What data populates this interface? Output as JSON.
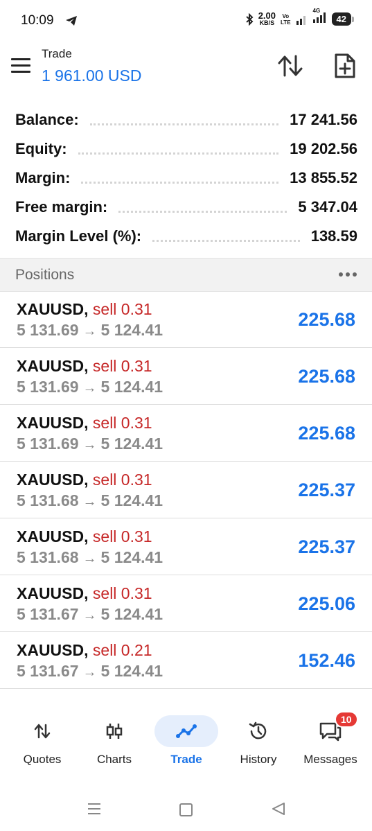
{
  "status_bar": {
    "time": "10:09",
    "speed_value": "2.00",
    "speed_unit": "KB/S",
    "volte_top": "Vo",
    "volte_bottom": "LTE",
    "network": "4G",
    "battery": "42"
  },
  "header": {
    "title": "Trade",
    "subtitle": "1 961.00 USD"
  },
  "summary": [
    {
      "label": "Balance:",
      "value": "17 241.56"
    },
    {
      "label": "Equity:",
      "value": "19 202.56"
    },
    {
      "label": "Margin:",
      "value": "13 855.52"
    },
    {
      "label": "Free margin:",
      "value": "5 347.04"
    },
    {
      "label": "Margin Level (%):",
      "value": "138.59"
    }
  ],
  "positions": {
    "title": "Positions",
    "items": [
      {
        "symbol": "XAUUSD,",
        "side": "sell 0.31",
        "open_price": "5 131.69",
        "arrow": "→",
        "current_price": "5 124.41",
        "profit": "225.68"
      },
      {
        "symbol": "XAUUSD,",
        "side": "sell 0.31",
        "open_price": "5 131.69",
        "arrow": "→",
        "current_price": "5 124.41",
        "profit": "225.68"
      },
      {
        "symbol": "XAUUSD,",
        "side": "sell 0.31",
        "open_price": "5 131.69",
        "arrow": "→",
        "current_price": "5 124.41",
        "profit": "225.68"
      },
      {
        "symbol": "XAUUSD,",
        "side": "sell 0.31",
        "open_price": "5 131.68",
        "arrow": "→",
        "current_price": "5 124.41",
        "profit": "225.37"
      },
      {
        "symbol": "XAUUSD,",
        "side": "sell 0.31",
        "open_price": "5 131.68",
        "arrow": "→",
        "current_price": "5 124.41",
        "profit": "225.37"
      },
      {
        "symbol": "XAUUSD,",
        "side": "sell 0.31",
        "open_price": "5 131.67",
        "arrow": "→",
        "current_price": "5 124.41",
        "profit": "225.06"
      },
      {
        "symbol": "XAUUSD,",
        "side": "sell 0.21",
        "open_price": "5 131.67",
        "arrow": "→",
        "current_price": "5 124.41",
        "profit": "152.46"
      }
    ]
  },
  "nav": {
    "items": [
      {
        "label": "Quotes",
        "icon": "quotes-icon"
      },
      {
        "label": "Charts",
        "icon": "charts-icon"
      },
      {
        "label": "Trade",
        "icon": "trade-icon",
        "active": true
      },
      {
        "label": "History",
        "icon": "history-icon"
      },
      {
        "label": "Messages",
        "icon": "messages-icon",
        "badge": "10"
      }
    ]
  },
  "colors": {
    "accent": "#1a73e8",
    "sell": "#c62828",
    "badge": "#e53935"
  }
}
